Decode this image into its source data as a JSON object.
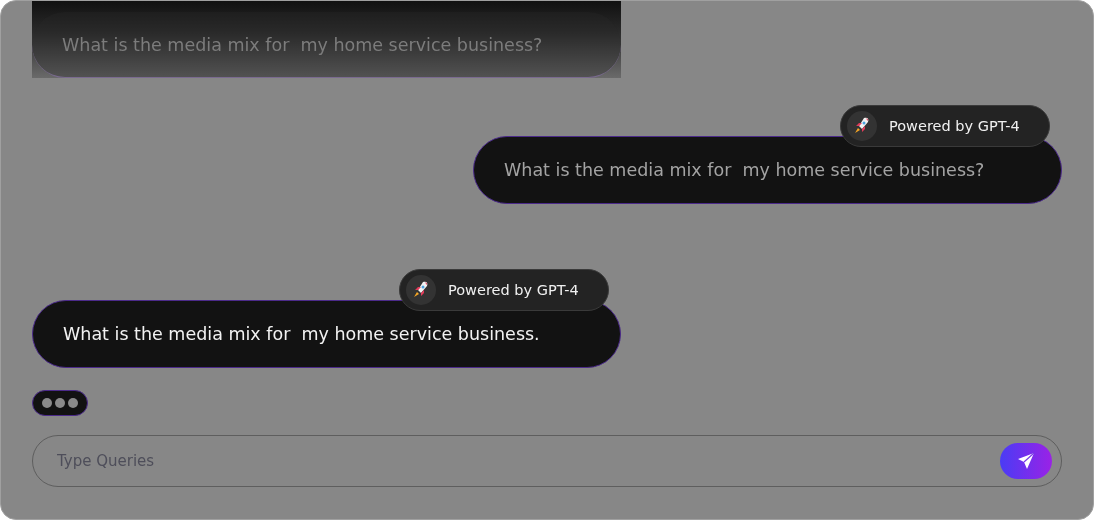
{
  "messages": [
    {
      "kind": "faded",
      "text": "What is the media mix for  my home service business?"
    },
    {
      "kind": "sent",
      "badge": "Powered by GPT-4",
      "text": "What is the media mix for  my home service business?"
    },
    {
      "kind": "received",
      "badge": "Powered by GPT-4",
      "text": "What is the media mix for  my home service business."
    }
  ],
  "typing_indicator": true,
  "composer": {
    "placeholder": "Type Queries"
  }
}
